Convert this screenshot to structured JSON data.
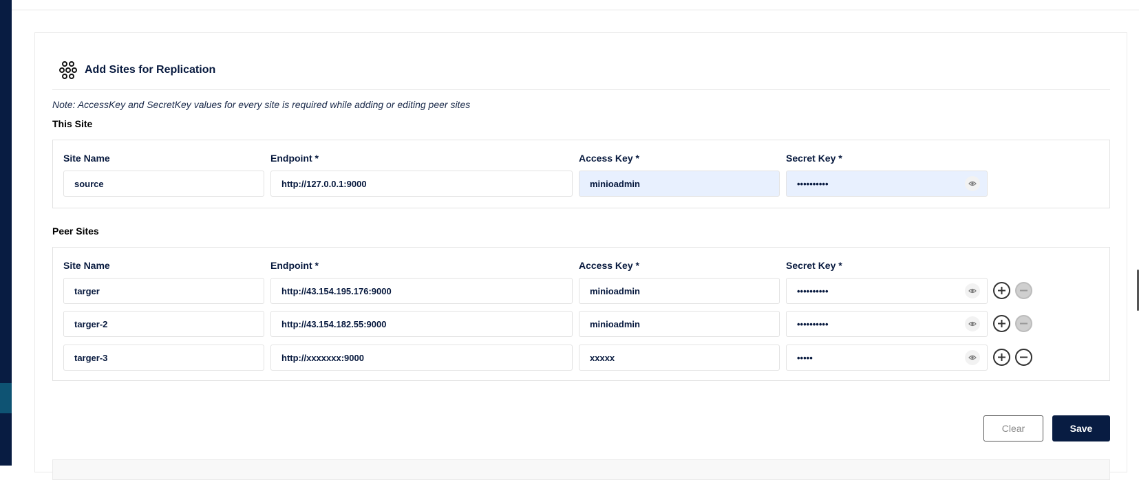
{
  "header": {
    "title": "Add Sites for Replication",
    "note": "Note: AccessKey and SecretKey values for every site is required while adding or editing peer sites"
  },
  "columns": {
    "site_name": "Site Name",
    "endpoint": "Endpoint *",
    "access_key": "Access Key *",
    "secret_key": "Secret Key *"
  },
  "this_site": {
    "title": "This Site",
    "site_name": "source",
    "endpoint": "http://127.0.0.1:9000",
    "access_key": "minioadmin",
    "secret_key": "••••••••••"
  },
  "peer_sites": {
    "title": "Peer Sites",
    "rows": [
      {
        "site_name": "targer",
        "endpoint": "http://43.154.195.176:9000",
        "access_key": "minioadmin",
        "secret_key": "••••••••••"
      },
      {
        "site_name": "targer-2",
        "endpoint": "http://43.154.182.55:9000",
        "access_key": "minioadmin",
        "secret_key": "••••••••••"
      },
      {
        "site_name": "targer-3",
        "endpoint": "http://xxxxxxx:9000",
        "access_key": "xxxxx",
        "secret_key": "•••••"
      }
    ]
  },
  "actions": {
    "clear_label": "Clear",
    "save_label": "Save"
  },
  "icons": {
    "header": "cluster-icon",
    "secret_toggle": "eye-icon",
    "add_row": "plus-circle-icon",
    "remove_row": "minus-circle-icon"
  },
  "colors": {
    "brand": "#081c42",
    "autofill": "#e8f0fe",
    "sidebar_accent": "#0e5373"
  }
}
